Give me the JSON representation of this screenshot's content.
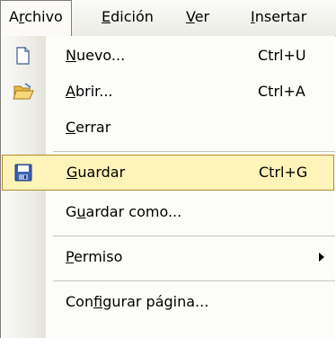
{
  "menubar": {
    "items": [
      {
        "pre": "A",
        "u": "r",
        "post": "chivo"
      },
      {
        "pre": "",
        "u": "E",
        "post": "dición"
      },
      {
        "pre": "",
        "u": "V",
        "post": "er"
      },
      {
        "pre": "",
        "u": "I",
        "post": "nsertar"
      }
    ]
  },
  "menu": {
    "items": [
      {
        "pre": "",
        "u": "N",
        "post": "uevo...",
        "shortcut": "Ctrl+U",
        "icon": "new-document-icon"
      },
      {
        "pre": "",
        "u": "A",
        "post": "brir...",
        "shortcut": "Ctrl+A",
        "icon": "open-folder-icon"
      },
      {
        "pre": "",
        "u": "C",
        "post": "errar",
        "shortcut": ""
      },
      {
        "pre": "",
        "u": "G",
        "post": "uardar",
        "shortcut": "Ctrl+G",
        "icon": "save-disk-icon"
      },
      {
        "pre": "G",
        "u": "u",
        "post": "ardar como...",
        "shortcut": ""
      },
      {
        "pre": "",
        "u": "P",
        "post": "ermiso",
        "shortcut": ""
      },
      {
        "pre": "Con",
        "u": "f",
        "post": "igurar página...",
        "shortcut": ""
      }
    ]
  },
  "colors": {
    "highlight": "#fef3b8",
    "highlight_border": "#b58a2e"
  }
}
